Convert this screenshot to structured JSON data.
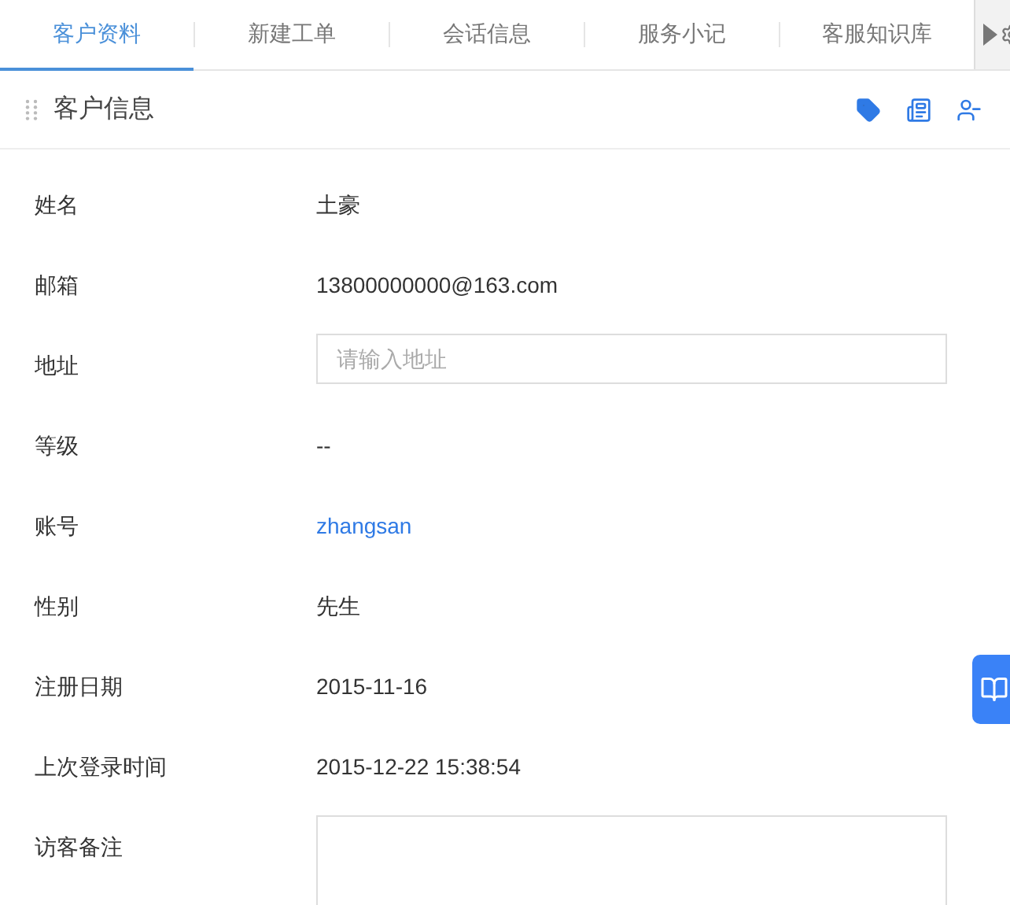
{
  "tabs": [
    {
      "label": "客户资料",
      "selected": true
    },
    {
      "label": "新建工单",
      "selected": false
    },
    {
      "label": "会话信息",
      "selected": false
    },
    {
      "label": "服务小记",
      "selected": false
    },
    {
      "label": "客服知识库",
      "selected": false
    }
  ],
  "panel": {
    "title": "客户信息"
  },
  "fields": [
    {
      "kind": "text",
      "label": "姓名",
      "value": "土豪"
    },
    {
      "kind": "text",
      "label": "邮箱",
      "value": "13800000000@163.com"
    },
    {
      "kind": "input",
      "label": "地址",
      "placeholder": "请输入地址"
    },
    {
      "kind": "text",
      "label": "等级",
      "value": "--"
    },
    {
      "kind": "link",
      "label": "账号",
      "value": "zhangsan"
    },
    {
      "kind": "text",
      "label": "性别",
      "value": "先生"
    },
    {
      "kind": "text",
      "label": "注册日期",
      "value": "2015-11-16"
    },
    {
      "kind": "text",
      "label": "上次登录时间",
      "value": "2015-12-22 15:38:54"
    },
    {
      "kind": "textarea",
      "label": "访客备注"
    }
  ]
}
